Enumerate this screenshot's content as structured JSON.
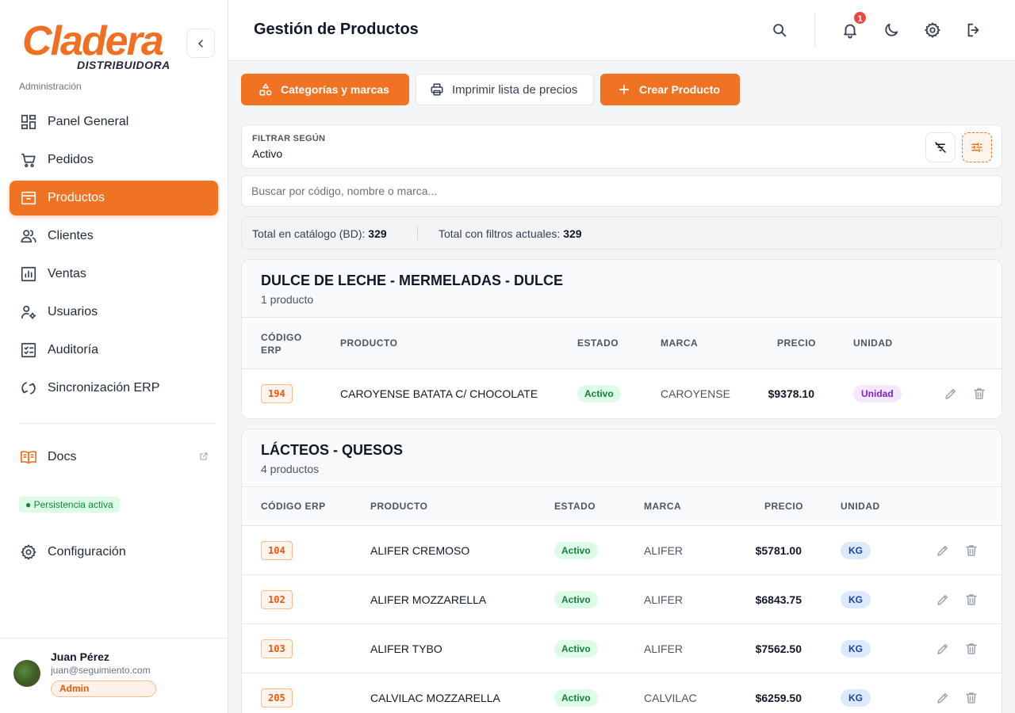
{
  "brand": {
    "logo_text": "Cladera",
    "logo_sub": "DISTRIBUIDORA",
    "section_label": "Administración"
  },
  "sidebar": {
    "items": [
      {
        "label": "Panel General",
        "icon": "dashboard-icon"
      },
      {
        "label": "Pedidos",
        "icon": "cart-icon"
      },
      {
        "label": "Productos",
        "icon": "archive-box-icon",
        "active": true
      },
      {
        "label": "Clientes",
        "icon": "users-icon"
      },
      {
        "label": "Ventas",
        "icon": "bar-chart-icon"
      },
      {
        "label": "Usuarios",
        "icon": "user-cog-icon"
      },
      {
        "label": "Auditoría",
        "icon": "checklist-icon"
      },
      {
        "label": "Sincronización ERP",
        "icon": "sync-icon"
      }
    ],
    "docs_label": "Docs",
    "persistence_badge": "● Persistencia activa",
    "config_label": "Configuración"
  },
  "user": {
    "name": "Juan Pérez",
    "email": "juan@seguimiento.com",
    "role": "Admin"
  },
  "header": {
    "title": "Gestión de Productos",
    "notification_count": "1"
  },
  "toolbar": {
    "categories_label": "Categorías y marcas",
    "print_label": "Imprimir lista de precios",
    "create_label": "Crear Producto"
  },
  "filter": {
    "label": "FILTRAR SEGÚN",
    "value": "Activo"
  },
  "search": {
    "placeholder": "Buscar por código, nombre o marca..."
  },
  "totals": {
    "catalog_label": "Total en catálogo (BD):",
    "catalog_value": "329",
    "filtered_label": "Total con filtros actuales:",
    "filtered_value": "329"
  },
  "groups": [
    {
      "title": "DULCE DE LECHE - MERMELADAS - DULCE",
      "subtitle": "1 producto",
      "headers": {
        "code": "CÓDIGO ERP",
        "product": "PRODUCTO",
        "status": "ESTADO",
        "brand": "MARCA",
        "price": "PRECIO",
        "unit": "UNIDAD"
      },
      "rows": [
        {
          "code": "194",
          "product": "CAROYENSE BATATA C/ CHOCOLATE",
          "status": "Activo",
          "brand": "CAROYENSE",
          "price": "$9378.10",
          "unit": "Unidad"
        }
      ]
    },
    {
      "title": "LÁCTEOS - QUESOS",
      "subtitle": "4 productos",
      "headers": {
        "code": "CÓDIGO ERP",
        "product": "PRODUCTO",
        "status": "ESTADO",
        "brand": "MARCA",
        "price": "PRECIO",
        "unit": "UNIDAD"
      },
      "rows": [
        {
          "code": "104",
          "product": "ALIFER CREMOSO",
          "status": "Activo",
          "brand": "ALIFER",
          "price": "$5781.00",
          "unit": "KG"
        },
        {
          "code": "102",
          "product": "ALIFER MOZZARELLA",
          "status": "Activo",
          "brand": "ALIFER",
          "price": "$6843.75",
          "unit": "KG"
        },
        {
          "code": "103",
          "product": "ALIFER TYBO",
          "status": "Activo",
          "brand": "ALIFER",
          "price": "$7562.50",
          "unit": "KG"
        },
        {
          "code": "205",
          "product": "CALVILAC MOZZARELLA",
          "status": "Activo",
          "brand": "CALVILAC",
          "price": "$6259.50",
          "unit": "KG"
        }
      ]
    }
  ],
  "colors": {
    "accent": "#f07324",
    "status_green": "#15803d",
    "unit_purple": "#7e22ce",
    "unit_blue": "#1e40af"
  }
}
